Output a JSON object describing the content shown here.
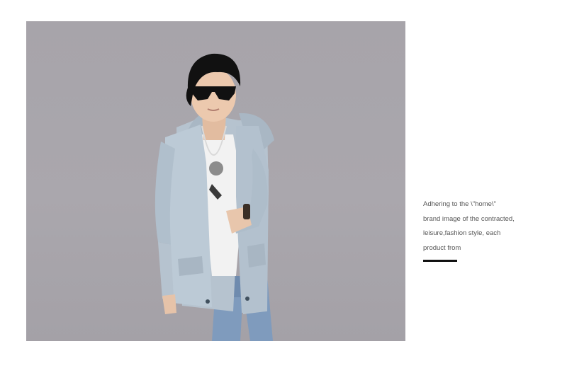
{
  "product_photo": {
    "subject": "boy in light blue hooded trench jacket, white t-shirt, jeans and dark sunglasses",
    "background_color": "#a8a5ab",
    "jacket_color": "#b6c3cf"
  },
  "caption": {
    "lines": [
      "Adhering to the \\\"home\\\"",
      "brand image of the contracted,",
      "leisure,fashion style, each",
      "product from"
    ],
    "rule_color": "#111111"
  }
}
